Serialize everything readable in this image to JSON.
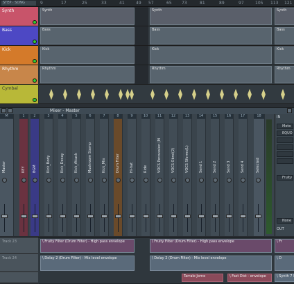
{
  "ruler": {
    "lcd": "STEP · SONG",
    "ticks": [
      "9",
      "17",
      "25",
      "33",
      "41",
      "49",
      "57",
      "65",
      "73",
      "81",
      "89",
      "97",
      "105",
      "113",
      "121"
    ]
  },
  "playlist": {
    "tracks": [
      {
        "label": "Synth",
        "color": "#c8546a"
      },
      {
        "label": "Bass",
        "color": "#4d48c4"
      },
      {
        "label": "Kick",
        "color": "#d47a2a"
      },
      {
        "label": "Rhythm",
        "color": "#c8864a"
      },
      {
        "label": "Cymbal",
        "color": "#b8b838"
      }
    ],
    "patterns": {
      "synth": "Synth",
      "bass": "Bass",
      "kick": "Kick",
      "rhythm": "Rhythm"
    }
  },
  "mixer": {
    "title": "Mixer - Master",
    "strips": [
      {
        "num": "M",
        "name": "Master"
      },
      {
        "num": "1",
        "name": "KEY"
      },
      {
        "num": "2",
        "name": "BGM"
      },
      {
        "num": "3",
        "name": "Kick_Body"
      },
      {
        "num": "4",
        "name": "Kick_Decay"
      },
      {
        "num": "5",
        "name": "Kick_Attack"
      },
      {
        "num": "6",
        "name": "Mushroom Stomp"
      },
      {
        "num": "7",
        "name": "Kick_Mix"
      },
      {
        "num": "8",
        "name": "Drum Filter"
      },
      {
        "num": "9",
        "name": "Hi-hat"
      },
      {
        "num": "10",
        "name": "Ride"
      },
      {
        "num": "11",
        "name": "VOCS Percussion (M"
      },
      {
        "num": "12",
        "name": "VOCS Obrol(2)"
      },
      {
        "num": "13",
        "name": "VOCS Sforms(L)"
      },
      {
        "num": "14",
        "name": "Send 1"
      },
      {
        "num": "15",
        "name": "Send 2"
      },
      {
        "num": "16",
        "name": "Send 3"
      },
      {
        "num": "17",
        "name": "Send 4"
      },
      {
        "num": "18",
        "name": "Selected"
      }
    ],
    "side": {
      "header": "IN",
      "rows": [
        "Moto",
        "EQUO",
        "",
        "",
        "",
        "",
        "Fruity"
      ],
      "footer": "None",
      "out": "OUT"
    }
  },
  "automation": {
    "tracks": [
      {
        "label": "Track 23"
      },
      {
        "label": "Track 24"
      },
      {
        "label": ""
      }
    ],
    "clips": {
      "a1": "\\ Fruity Filter (Drum Filter) - High pass envelope",
      "a2": "\\ Fruity Filter (Drum Filter) - High pass envelope",
      "a3": "\\ Fr",
      "b1": "\\ Delay 2 (Drum Filter) - Mix level envelope",
      "b2": "\\ Delay 2 (Drum Filter) - Mix level envelope",
      "b3": "\\ D",
      "c1": "Tarrale Jorne",
      "c2": "\\ Fast Dist - envelope",
      "c3": "\\ Synth 7 Mix"
    }
  }
}
